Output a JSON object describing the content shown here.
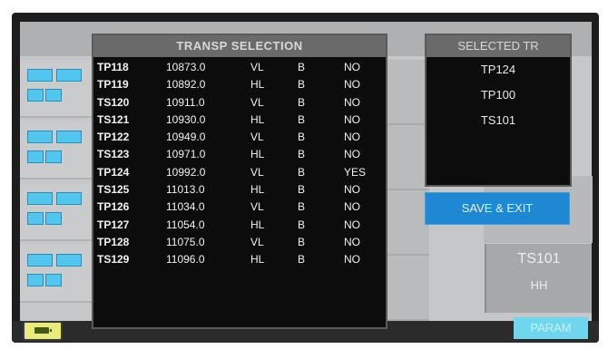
{
  "transp_dialog": {
    "title": "TRANSP  SELECTION",
    "rows": [
      {
        "id": "TP118",
        "freq": "10873.0",
        "pol": "VL",
        "band": "B",
        "selected": "NO"
      },
      {
        "id": "TP119",
        "freq": "10892.0",
        "pol": "HL",
        "band": "B",
        "selected": "NO"
      },
      {
        "id": "TS120",
        "freq": "10911.0",
        "pol": "VL",
        "band": "B",
        "selected": "NO"
      },
      {
        "id": "TS121",
        "freq": "10930.0",
        "pol": "HL",
        "band": "B",
        "selected": "NO"
      },
      {
        "id": "TP122",
        "freq": "10949.0",
        "pol": "VL",
        "band": "B",
        "selected": "NO"
      },
      {
        "id": "TS123",
        "freq": "10971.0",
        "pol": "HL",
        "band": "B",
        "selected": "NO"
      },
      {
        "id": "TP124",
        "freq": "10992.0",
        "pol": "VL",
        "band": "B",
        "selected": "YES"
      },
      {
        "id": "TS125",
        "freq": "11013.0",
        "pol": "HL",
        "band": "B",
        "selected": "NO"
      },
      {
        "id": "TP126",
        "freq": "11034.0",
        "pol": "VL",
        "band": "B",
        "selected": "NO"
      },
      {
        "id": "TP127",
        "freq": "11054.0",
        "pol": "HL",
        "band": "B",
        "selected": "NO"
      },
      {
        "id": "TP128",
        "freq": "11075.0",
        "pol": "VL",
        "band": "B",
        "selected": "NO"
      },
      {
        "id": "TS129",
        "freq": "11096.0",
        "pol": "HL",
        "band": "B",
        "selected": "NO"
      }
    ]
  },
  "selected_panel": {
    "title": "SELECTED TR",
    "items": [
      "TP124",
      "TP100",
      "TS101"
    ]
  },
  "save_button": {
    "label": "SAVE & EXIT"
  },
  "background": {
    "tile_line1": "TS101",
    "tile_line2": "HH",
    "param_label": "PARAM"
  },
  "colors": {
    "accent_button": "#1e88d2",
    "pill": "#52c6ee",
    "battery": "#e9ec7a",
    "dialog_bg": "#0c0c0c",
    "title_bar": "#6a6a6a"
  }
}
